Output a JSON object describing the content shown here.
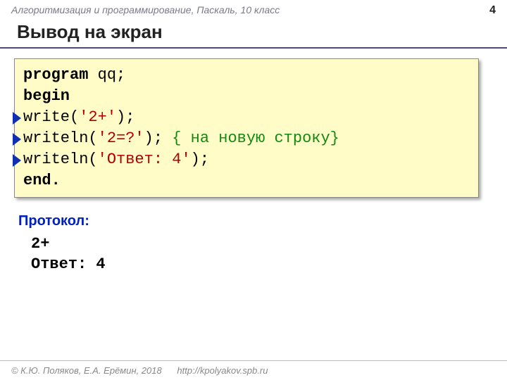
{
  "header": {
    "course": "Алгоритмизация и программирование, Паскаль, 10 класс",
    "page": "4"
  },
  "title": "Вывод на экран",
  "code": {
    "l1a": "program",
    "l1b": " qq;",
    "l2": "begin",
    "l3a": "  write(",
    "l3b": "'2+'",
    "l3c": ");",
    "l4a": "  writeln(",
    "l4b": "'2=?'",
    "l4c": "); ",
    "l4d": "{ на новую строку}",
    "l5a": "  writeln(",
    "l5b": "'Ответ: 4'",
    "l5c": ");",
    "l6": "end."
  },
  "protocol": {
    "label": "Протокол:",
    "out1": "2+",
    "out2": "Ответ: 4"
  },
  "footer": {
    "copyright": "© К.Ю. Поляков, Е.А. Ерёмин, 2018",
    "url": "http://kpolyakov.spb.ru"
  }
}
